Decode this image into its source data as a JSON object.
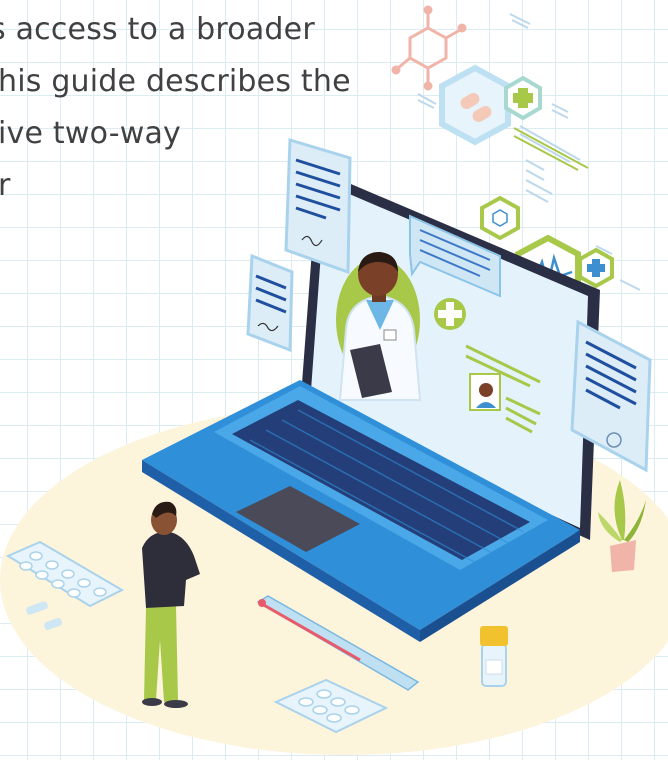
{
  "article": {
    "line1": "s access to a broader",
    "line2": "his guide describes the",
    "line3": "ive two-way",
    "line4": "r"
  },
  "illustration": {
    "subject": "telehealth video consultation on a laptop",
    "icons": [
      "doctor-avatar",
      "medical-cross-icon",
      "chat-bubble-icon",
      "prescription-document-icon",
      "pill-blister-icon",
      "thermometer-icon",
      "medicine-bottle-icon",
      "plant-icon",
      "molecule-icon",
      "heartbeat-icon"
    ],
    "colors": {
      "laptop_blue": "#2f8fd8",
      "laptop_dark": "#1f5fa8",
      "keyboard": "#233e78",
      "accent_green": "#a8c84a",
      "floor_cream": "#fdf4dc",
      "doc_blue": "#cfe6f5",
      "text_gray": "#414042"
    }
  }
}
